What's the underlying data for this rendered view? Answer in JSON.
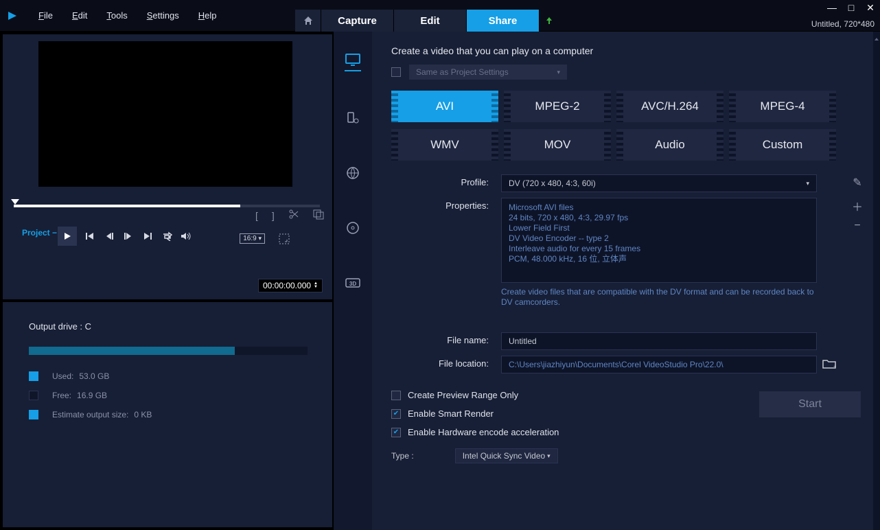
{
  "menu": {
    "file": "File",
    "edit": "Edit",
    "tools": "Tools",
    "settings": "Settings",
    "help": "Help"
  },
  "tabs": {
    "capture": "Capture",
    "edit": "Edit",
    "share": "Share"
  },
  "title_info": "Untitled, 720*480",
  "preview": {
    "project_label": "Project",
    "aspect": "16:9",
    "timecode": "00:00:00.000"
  },
  "output": {
    "heading": "Output drive : C",
    "used_label": "Used:",
    "used_value": "53.0 GB",
    "free_label": "Free:",
    "free_value": "16.9 GB",
    "est_label": "Estimate output size:",
    "est_value": "0 KB"
  },
  "share": {
    "title": "Create a video that you can play on a computer",
    "same_as": "Same as Project Settings",
    "formats": [
      "AVI",
      "MPEG-2",
      "AVC/H.264",
      "MPEG-4",
      "WMV",
      "MOV",
      "Audio",
      "Custom"
    ],
    "profile_label": "Profile:",
    "profile_value": "DV (720 x 480, 4:3, 60i)",
    "properties_label": "Properties:",
    "props": [
      "Microsoft AVI files",
      "24 bits, 720 x 480, 4:3, 29.97 fps",
      "Lower Field First",
      "DV Video Encoder -- type 2",
      "Interleave audio for every 15 frames",
      "PCM, 48.000 kHz, 16 位, 立体声"
    ],
    "prop_note": "Create video files that are compatible with the DV format and can be recorded back to DV camcorders.",
    "filename_label": "File name:",
    "filename_value": "Untitled",
    "fileloc_label": "File location:",
    "fileloc_value": "C:\\Users\\jiazhiyun\\Documents\\Corel VideoStudio Pro\\22.0\\",
    "opt_preview": "Create Preview Range Only",
    "opt_smart": "Enable Smart Render",
    "opt_hw": "Enable Hardware encode acceleration",
    "type_label": "Type :",
    "type_value": "Intel Quick Sync Video",
    "start": "Start"
  }
}
